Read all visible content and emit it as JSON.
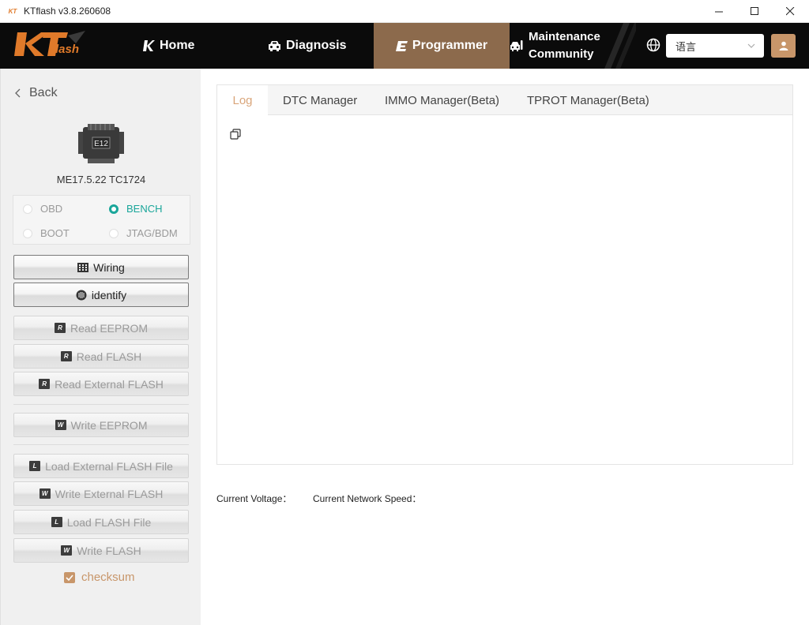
{
  "window": {
    "title": "KTflash v3.8.260608",
    "logo_text": "KT"
  },
  "nav": {
    "brand": "KTflash",
    "home": "Home",
    "diagnosis": "Diagnosis",
    "programmer": "Programmer",
    "maintenance_line1": "Maintenance",
    "maintenance_line2": "Community",
    "language": "语言",
    "accent_color": "#8c6a4c"
  },
  "sidebar": {
    "back": "Back",
    "ecu_chip_label": "E12",
    "ecu_name": "ME17.5.22 TC1724",
    "modes": [
      {
        "label": "OBD",
        "selected": false
      },
      {
        "label": "BENCH",
        "selected": true
      },
      {
        "label": "BOOT",
        "selected": false
      },
      {
        "label": "JTAG/BDM",
        "selected": false
      }
    ],
    "buttons": {
      "wiring": "Wiring",
      "identify": "identify",
      "read_eeprom": "Read EEPROM",
      "read_flash": "Read FLASH",
      "read_ext_flash": "Read External FLASH",
      "write_eeprom": "Write EEPROM",
      "load_ext_flash_file": "Load External FLASH File",
      "write_ext_flash": "Write External FLASH",
      "load_flash_file": "Load FLASH File",
      "write_flash": "Write FLASH"
    },
    "icon_letters": {
      "read": "R",
      "write": "W",
      "load": "L"
    },
    "checksum": {
      "label": "checksum",
      "checked": true
    }
  },
  "main": {
    "tabs": [
      "Log",
      "DTC Manager",
      "IMMO Manager(Beta)",
      "TPROT Manager(Beta)"
    ],
    "active_tab": "Log",
    "current_voltage": "Current Voltage：",
    "current_network_speed": "Current Network Speed："
  }
}
